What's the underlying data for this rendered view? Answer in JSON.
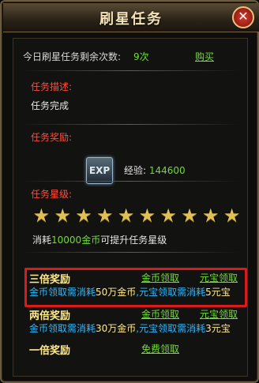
{
  "header": {
    "title": "刷星任务"
  },
  "count_row": {
    "label": "今日刷星任务剩余次数:",
    "value": "9次",
    "buy": "购买"
  },
  "task_desc": {
    "label": "任务描述:",
    "text": "任务完成"
  },
  "task_reward": {
    "label": "任务奖励:",
    "icon_text": "EXP",
    "exp_label": "经验:",
    "exp_value": "144600"
  },
  "task_stars": {
    "label": "任务星级:",
    "count": 10
  },
  "cost": {
    "pre": "消耗",
    "amount": "10000金币",
    "post": "可提升任务星级"
  },
  "tiers": [
    {
      "name": "三倍奖励",
      "link1": "金币领取",
      "link2": "元宝领取",
      "desc_a": "金币领取需消耗",
      "desc_b": "50万金币",
      "desc_c": ",元宝领取需消耗",
      "desc_d": "5元宝"
    },
    {
      "name": "两倍奖励",
      "link1": "金币领取",
      "link2": "元宝领取",
      "desc_a": "金币领取需消耗",
      "desc_b": "30万金币",
      "desc_c": ",元宝领取需消耗",
      "desc_d": "3元宝"
    },
    {
      "name": "一倍奖励",
      "link1": "免费领取"
    }
  ],
  "colors": {
    "accent_green": "#6ddf2e",
    "label_red": "#ff4d3a",
    "blue_text": "#2fb8ff",
    "highlight_red": "#d81b1b"
  }
}
